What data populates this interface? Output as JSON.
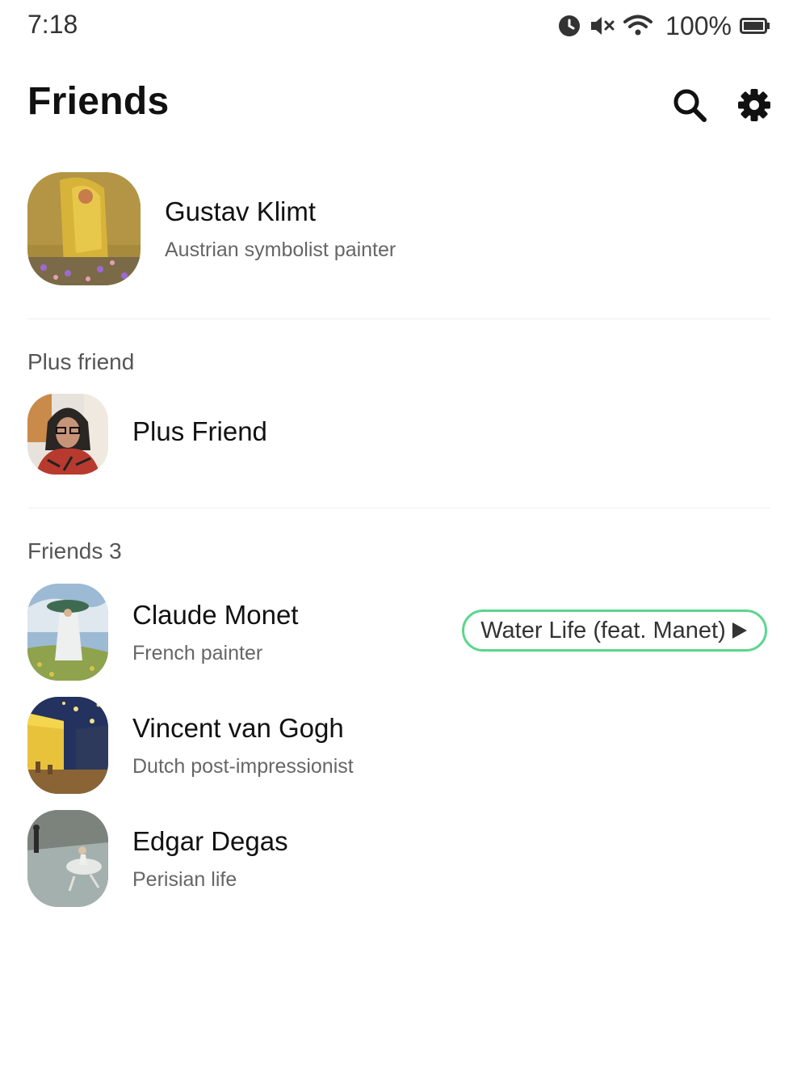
{
  "status_bar": {
    "time": "7:18",
    "battery": "100%",
    "icons": [
      "alarm-icon",
      "mute-icon",
      "wifi-icon",
      "battery-icon"
    ]
  },
  "header": {
    "title": "Friends",
    "actions": [
      "search-icon",
      "gear-icon"
    ]
  },
  "profile": {
    "name": "Gustav Klimt",
    "status": "Austrian symbolist painter"
  },
  "plus_section": {
    "title": "Plus friend",
    "items": [
      {
        "name": "Plus Friend"
      }
    ]
  },
  "friends_section": {
    "title": "Friends 3",
    "items": [
      {
        "name": "Claude Monet",
        "status": "French painter",
        "music": "Water Life (feat. Manet)"
      },
      {
        "name": "Vincent van Gogh",
        "status": "Dutch post-impressionist"
      },
      {
        "name": "Edgar Degas",
        "status": "Perisian life"
      }
    ]
  },
  "colors": {
    "accent_green": "#5bd68d",
    "text_primary": "#111111",
    "text_secondary": "#666666"
  }
}
